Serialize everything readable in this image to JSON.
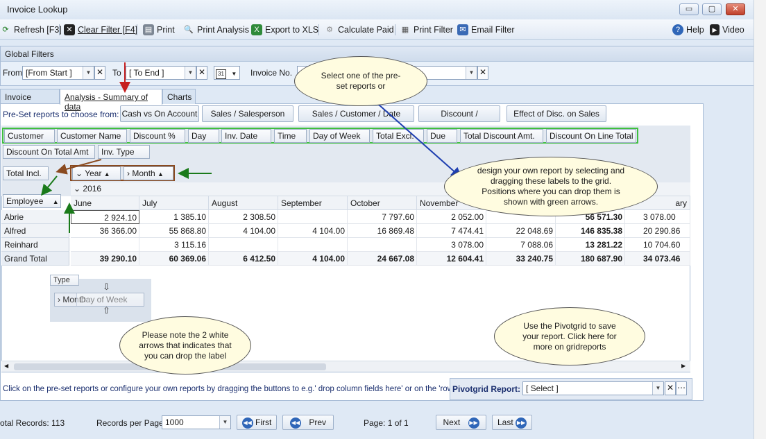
{
  "window": {
    "title": "Invoice Lookup",
    "minimize": "▭",
    "maximize": "▢",
    "close": "✕"
  },
  "toolbar": {
    "refresh": "Refresh [F3]",
    "clear_filter": "Clear Filter [F4]",
    "print": "Print",
    "print_analysis": "Print Analysis",
    "export": "Export to XLS",
    "calculate_paid": "Calculate Paid",
    "print_filter": "Print Filter",
    "email_filter": "Email Filter",
    "help": "Help",
    "video": "Video"
  },
  "global_filters": {
    "title": "Global Filters",
    "from_label": "From",
    "from_value": "[From Start ]",
    "to_label": "To",
    "to_value": "[ To End ]",
    "calendar": "31",
    "invoice_label": "Invoice No."
  },
  "tabs": [
    "Invoice Lookup",
    "Analysis - Summary of data",
    "Charts"
  ],
  "presets": {
    "label": "Pre-Set reports to choose from:",
    "buttons": [
      "Cash vs On Account",
      "Sales / Salesperson",
      "Sales / Customer / Date",
      "Discount / Salesperson",
      "Effect of Disc. on Sales"
    ]
  },
  "filter_fields": [
    "Customer",
    "Customer Name",
    "Discount %",
    "Day",
    "Inv. Date",
    "Time",
    "Day of Week",
    "Total Excl.",
    "Due",
    "Total Discount Amt.",
    "Discount On Line Total",
    "Discount On Total Amt",
    "Inv. Type"
  ],
  "data_field": "Total Incl.",
  "column_fields": [
    "Year",
    "Month"
  ],
  "row_field": "Employee",
  "year": "2016",
  "months": [
    "June",
    "July",
    "August",
    "September",
    "October",
    "November",
    "",
    "",
    "ary"
  ],
  "rows": [
    {
      "name": "Abrie",
      "values": [
        "2 924.10",
        "1 385.10",
        "2 308.50",
        "",
        "7 797.60",
        "2 052.00",
        "",
        "56 571.30",
        "3 078.00"
      ]
    },
    {
      "name": "Alfred",
      "values": [
        "36 366.00",
        "55 868.80",
        "4 104.00",
        "4 104.00",
        "16 869.48",
        "7 474.41",
        "22 048.69",
        "146 835.38",
        "20 290.86"
      ]
    },
    {
      "name": "Reinhard",
      "values": [
        "",
        "3 115.16",
        "",
        "",
        "",
        "3 078.00",
        "7 088.06",
        "13 281.22",
        "10 704.60"
      ]
    },
    {
      "name": "Grand Total",
      "values": [
        "39 290.10",
        "60 369.06",
        "6 412.50",
        "4 104.00",
        "24 667.08",
        "12 604.41",
        "33 240.75",
        "180 687.90",
        "34 073.46"
      ]
    }
  ],
  "drag_demo": {
    "type_label": "Type",
    "month_label": "Month",
    "dragging_label": "Day of Week"
  },
  "callouts": {
    "preset": "Select one of the pre-set reports or",
    "design": "design your own report by selecting and dragging these labels to the grid. Positions where you can drop them is shown with green arrows.",
    "arrows": "Please note the 2 white arrows that indicates that you can drop the label",
    "pivotgrid": "Use the Pivotgrid to save your report. Click here for more on gridreports"
  },
  "hint": "Click on the pre-set reports  or configure your own reports by dragging the buttons to e.g.' drop column fields here' or on the 'row' or '",
  "pivotgrid_report": {
    "label": "Pivotgrid Report:",
    "value": "[ Select ]"
  },
  "footer": {
    "total_records": "otal Records: 113",
    "per_page_label": "Records per Page:",
    "per_page_value": "1000",
    "first": "First",
    "prev": "Prev",
    "page": "Page: 1 of 1",
    "next": "Next",
    "last": "Last"
  },
  "colors": {
    "green_border": "#3fbf3f",
    "brown_border": "#8a4a1f",
    "callout_fill": "#fffce0",
    "arrow_blue": "#1f3fb0"
  }
}
